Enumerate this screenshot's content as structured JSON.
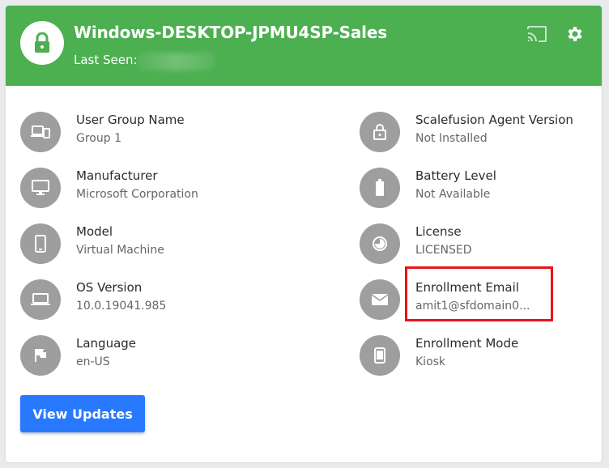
{
  "header": {
    "device_name": "Windows-DESKTOP-JPMU4SP-Sales",
    "last_seen_label": "Last Seen:"
  },
  "colors": {
    "header_bg": "#4caf50",
    "icon_circle": "#9e9e9e",
    "primary_button": "#2979ff",
    "highlight": "#e8141a"
  },
  "left_items": [
    {
      "label": "User Group Name",
      "value": "Group 1",
      "icon": "devices-icon"
    },
    {
      "label": "Manufacturer",
      "value": "Microsoft Corporation",
      "icon": "monitor-icon"
    },
    {
      "label": "Model",
      "value": "Virtual Machine",
      "icon": "phone-icon"
    },
    {
      "label": "OS Version",
      "value": "10.0.19041.985",
      "icon": "laptop-icon"
    },
    {
      "label": "Language",
      "value": "en-US",
      "icon": "flag-icon"
    }
  ],
  "right_items": [
    {
      "label": "Scalefusion Agent Version",
      "value": "Not Installed",
      "icon": "lock-icon"
    },
    {
      "label": "Battery Level",
      "value": "Not Available",
      "icon": "battery-icon"
    },
    {
      "label": "License",
      "value": "LICENSED",
      "icon": "license-icon"
    },
    {
      "label": "Enrollment Email",
      "value": "amit1@sfdomain0...",
      "icon": "mail-icon"
    },
    {
      "label": "Enrollment Mode",
      "value": "Kiosk",
      "icon": "tablet-icon"
    }
  ],
  "actions": {
    "view_updates_label": "View Updates"
  }
}
